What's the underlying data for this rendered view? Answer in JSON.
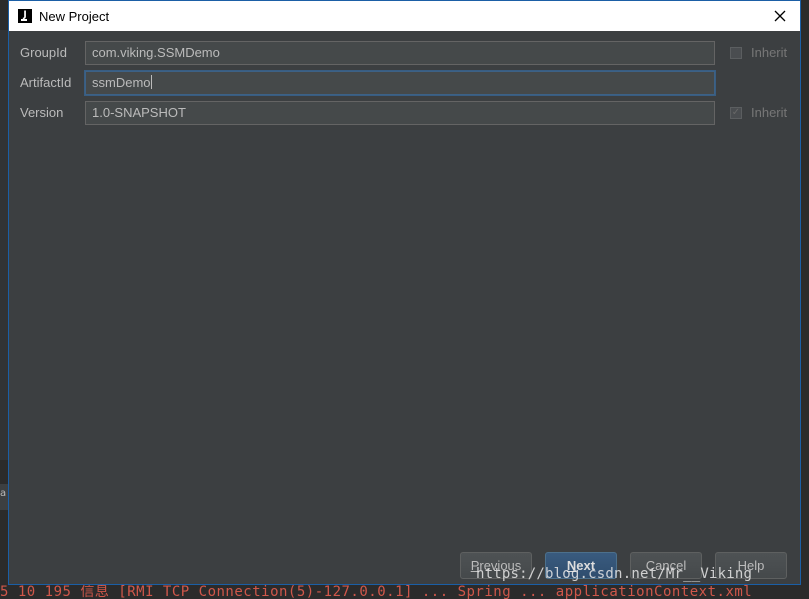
{
  "window": {
    "title": "New Project",
    "icon": "intellij-icon"
  },
  "form": {
    "group_id": {
      "label": "GroupId",
      "value": "com.viking.SSMDemo",
      "inherit_label": "Inherit",
      "inherit_checked": false
    },
    "artifact_id": {
      "label": "ArtifactId",
      "value": "ssmDemo"
    },
    "version": {
      "label": "Version",
      "value": "1.0-SNAPSHOT",
      "inherit_label": "Inherit",
      "inherit_checked": true
    }
  },
  "buttons": {
    "previous": {
      "mnemonic": "P",
      "rest": "revious"
    },
    "next": {
      "mnemonic": "N",
      "rest": "ext"
    },
    "cancel": "Cancel",
    "help": "Help"
  },
  "background": {
    "log_line": "5 10 195 信息 [RMI TCP Connection(5)-127.0.0.1] ... Spring ... applicationContext.xml",
    "left_tab": "a"
  },
  "watermark": "https://blog.csdn.net/Mr__Viking",
  "colors": {
    "dialog_bg": "#3c3f41",
    "accent": "#1b5fa6",
    "default_button": "#365880"
  }
}
